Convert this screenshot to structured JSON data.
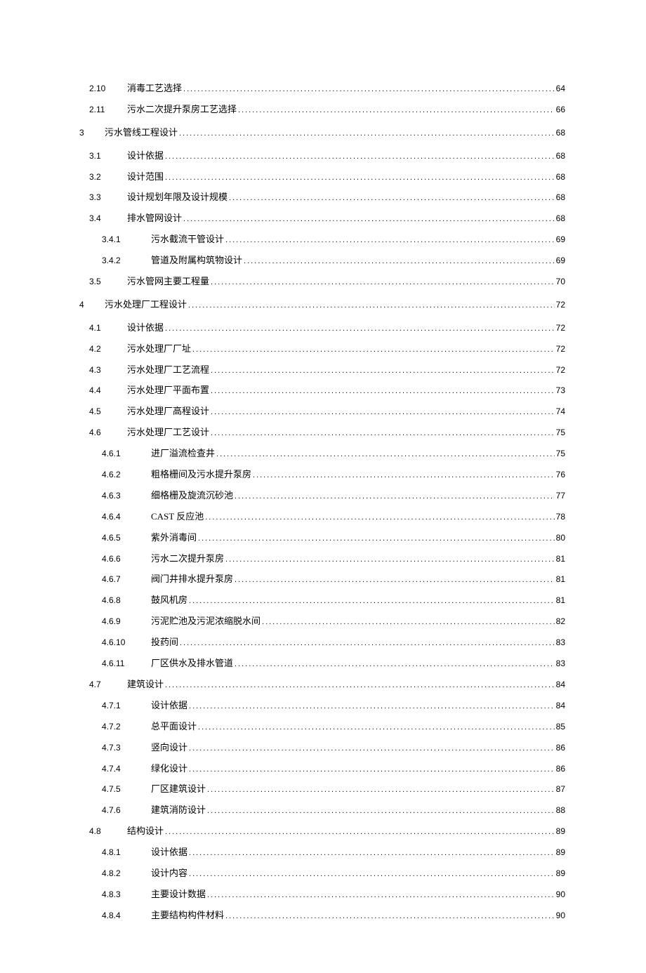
{
  "toc": [
    {
      "level": 2,
      "num": "2.10",
      "title": "消毒工艺选择",
      "page": "64"
    },
    {
      "level": 2,
      "num": "2.11",
      "title": "污水二次提升泵房工艺选择",
      "page": "66"
    },
    {
      "level": 1,
      "num": "3",
      "title": "污水管线工程设计",
      "page": "68"
    },
    {
      "level": 2,
      "num": "3.1",
      "title": "设计依据",
      "page": "68"
    },
    {
      "level": 2,
      "num": "3.2",
      "title": "设计范围",
      "page": "68"
    },
    {
      "level": 2,
      "num": "3.3",
      "title": "设计规划年限及设计规模",
      "page": "68"
    },
    {
      "level": 2,
      "num": "3.4",
      "title": "排水管网设计",
      "page": "68"
    },
    {
      "level": 3,
      "num": "3.4.1",
      "title": "污水截流干管设计",
      "page": "69"
    },
    {
      "level": 3,
      "num": "3.4.2",
      "title": "管道及附属构筑物设计",
      "page": "69"
    },
    {
      "level": 2,
      "num": "3.5",
      "title": "污水管网主要工程量",
      "page": "70"
    },
    {
      "level": 1,
      "num": "4",
      "title": "污水处理厂工程设计",
      "page": "72"
    },
    {
      "level": 2,
      "num": "4.1",
      "title": "设计依据",
      "page": "72"
    },
    {
      "level": 2,
      "num": "4.2",
      "title": "污水处理厂厂址",
      "page": "72"
    },
    {
      "level": 2,
      "num": "4.3",
      "title": "污水处理厂工艺流程",
      "page": "72"
    },
    {
      "level": 2,
      "num": "4.4",
      "title": "污水处理厂平面布置",
      "page": "73"
    },
    {
      "level": 2,
      "num": "4.5",
      "title": "污水处理厂高程设计",
      "page": "74"
    },
    {
      "level": 2,
      "num": "4.6",
      "title": "污水处理厂工艺设计",
      "page": "75"
    },
    {
      "level": 3,
      "num": "4.6.1",
      "title": "进厂溢流检查井",
      "page": "75"
    },
    {
      "level": 3,
      "num": "4.6.2",
      "title": "粗格栅间及污水提升泵房",
      "page": "76"
    },
    {
      "level": 3,
      "num": "4.6.3",
      "title": "细格栅及旋流沉砂池",
      "page": "77"
    },
    {
      "level": 3,
      "num": "4.6.4",
      "title": "CAST 反应池",
      "page": "78"
    },
    {
      "level": 3,
      "num": "4.6.5",
      "title": "紫外消毒间",
      "page": "80"
    },
    {
      "level": 3,
      "num": "4.6.6",
      "title": "污水二次提升泵房",
      "page": "81"
    },
    {
      "level": 3,
      "num": "4.6.7",
      "title": "阀门井排水提升泵房",
      "page": "81"
    },
    {
      "level": 3,
      "num": "4.6.8",
      "title": "鼓风机房",
      "page": "81"
    },
    {
      "level": 3,
      "num": "4.6.9",
      "title": "污泥贮池及污泥浓缩脱水间",
      "page": "82"
    },
    {
      "level": 3,
      "num": "4.6.10",
      "title": "投药间",
      "page": "83"
    },
    {
      "level": 3,
      "num": "4.6.11",
      "title": "厂区供水及排水管道",
      "page": "83"
    },
    {
      "level": 2,
      "num": "4.7",
      "title": "建筑设计",
      "page": "84"
    },
    {
      "level": 3,
      "num": "4.7.1",
      "title": "设计依据",
      "page": "84"
    },
    {
      "level": 3,
      "num": "4.7.2",
      "title": "总平面设计",
      "page": "85"
    },
    {
      "level": 3,
      "num": "4.7.3",
      "title": "竖向设计",
      "page": "86"
    },
    {
      "level": 3,
      "num": "4.7.4",
      "title": "绿化设计",
      "page": "86"
    },
    {
      "level": 3,
      "num": "4.7.5",
      "title": "厂区建筑设计",
      "page": "87"
    },
    {
      "level": 3,
      "num": "4.7.6",
      "title": "建筑消防设计",
      "page": "88"
    },
    {
      "level": 2,
      "num": "4.8",
      "title": "结构设计",
      "page": "89"
    },
    {
      "level": 3,
      "num": "4.8.1",
      "title": "设计依据",
      "page": "89"
    },
    {
      "level": 3,
      "num": "4.8.2",
      "title": "设计内容",
      "page": "89"
    },
    {
      "level": 3,
      "num": "4.8.3",
      "title": "主要设计数据",
      "page": "90"
    },
    {
      "level": 3,
      "num": "4.8.4",
      "title": "主要结构构件材料",
      "page": "90"
    }
  ]
}
